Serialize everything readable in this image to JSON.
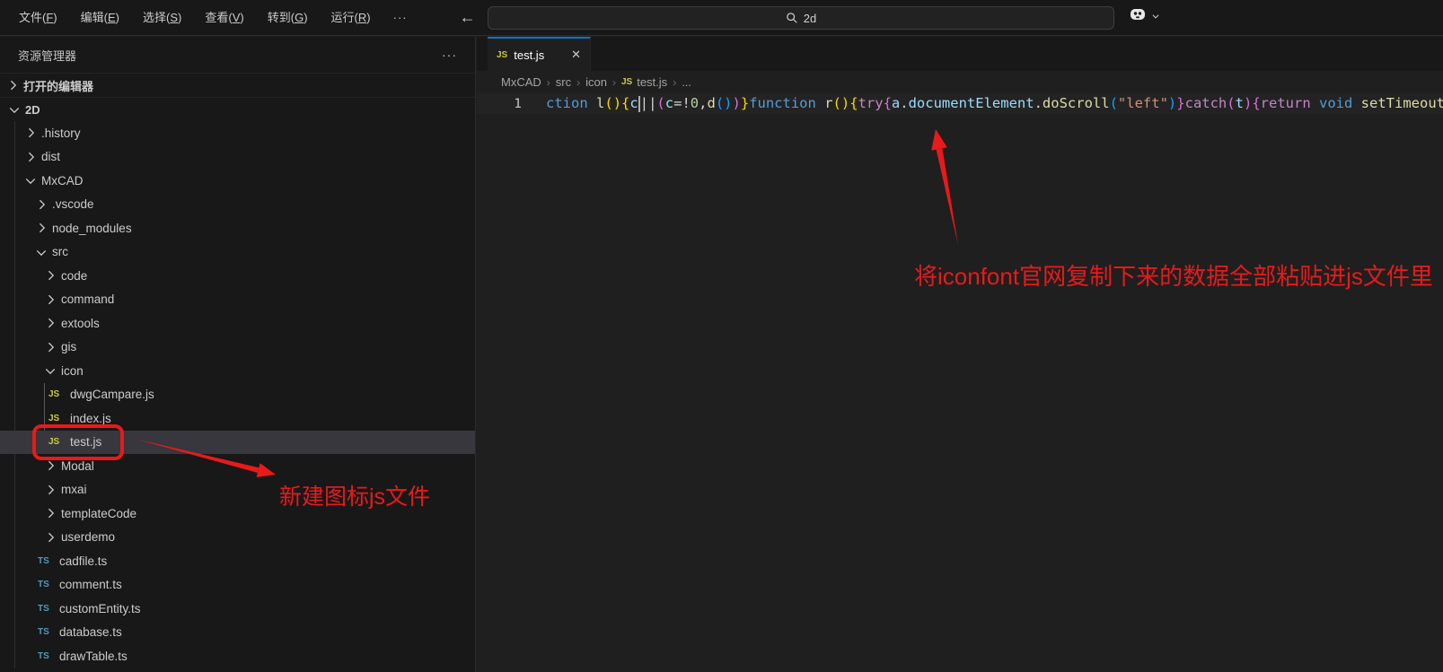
{
  "titlebar": {
    "menus": [
      {
        "text": "文件",
        "key": "F"
      },
      {
        "text": "编辑",
        "key": "E"
      },
      {
        "text": "选择",
        "key": "S"
      },
      {
        "text": "查看",
        "key": "V"
      },
      {
        "text": "转到",
        "key": "G"
      },
      {
        "text": "运行",
        "key": "R"
      }
    ],
    "overflow": "···",
    "search_value": "2d"
  },
  "icons": {
    "close": "✕",
    "js_badge": "JS",
    "ts_badge": "TS",
    "more": "···",
    "back": "←",
    "forward": "→"
  },
  "sidebar": {
    "title": "资源管理器",
    "open_editors_label": "打开的编辑器",
    "root_label": "2D",
    "tree": [
      {
        "name": ".history",
        "kind": "folder",
        "level": 1
      },
      {
        "name": "dist",
        "kind": "folder",
        "level": 1
      },
      {
        "name": "MxCAD",
        "kind": "folder",
        "level": 1,
        "expanded": true
      },
      {
        "name": ".vscode",
        "kind": "folder",
        "level": 2
      },
      {
        "name": "node_modules",
        "kind": "folder",
        "level": 2
      },
      {
        "name": "src",
        "kind": "folder",
        "level": 2,
        "expanded": true
      },
      {
        "name": "code",
        "kind": "folder",
        "level": 3
      },
      {
        "name": "command",
        "kind": "folder",
        "level": 3
      },
      {
        "name": "extools",
        "kind": "folder",
        "level": 3
      },
      {
        "name": "gis",
        "kind": "folder",
        "level": 3
      },
      {
        "name": "icon",
        "kind": "folder",
        "level": 3,
        "expanded": true
      },
      {
        "name": "dwgCampare.js",
        "kind": "js",
        "level": 4
      },
      {
        "name": "index.js",
        "kind": "js",
        "level": 4
      },
      {
        "name": "test.js",
        "kind": "js",
        "level": 4,
        "selected": true
      },
      {
        "name": "Modal",
        "kind": "folder",
        "level": 3
      },
      {
        "name": "mxai",
        "kind": "folder",
        "level": 3
      },
      {
        "name": "templateCode",
        "kind": "folder",
        "level": 3
      },
      {
        "name": "userdemo",
        "kind": "folder",
        "level": 3
      },
      {
        "name": "cadfile.ts",
        "kind": "ts",
        "level": 3
      },
      {
        "name": "comment.ts",
        "kind": "ts",
        "level": 3
      },
      {
        "name": "customEntity.ts",
        "kind": "ts",
        "level": 3
      },
      {
        "name": "database.ts",
        "kind": "ts",
        "level": 3
      },
      {
        "name": "drawTable.ts",
        "kind": "ts",
        "level": 3
      }
    ]
  },
  "editor": {
    "tab": {
      "label": "test.js"
    },
    "breadcrumb": [
      {
        "label": "MxCAD"
      },
      {
        "label": "src"
      },
      {
        "label": "icon"
      },
      {
        "label": "test.js",
        "icon": "js"
      },
      {
        "label": "..."
      }
    ],
    "line_number": "1",
    "code_tokens": [
      {
        "t": "ction",
        "c": "kw"
      },
      {
        "t": " ",
        "c": "fg"
      },
      {
        "t": "l",
        "c": "fn"
      },
      {
        "t": "(",
        "c": "b1"
      },
      {
        "t": ")",
        "c": "b1"
      },
      {
        "t": "{",
        "c": "b1"
      },
      {
        "t": "c",
        "c": "var"
      },
      {
        "t": "",
        "c": "cursor"
      },
      {
        "t": "||",
        "c": "fg"
      },
      {
        "t": "(",
        "c": "b2"
      },
      {
        "t": "c",
        "c": "var"
      },
      {
        "t": "=",
        "c": "fg"
      },
      {
        "t": "!",
        "c": "fg"
      },
      {
        "t": "0",
        "c": "num"
      },
      {
        "t": ",",
        "c": "fg"
      },
      {
        "t": "d",
        "c": "fn"
      },
      {
        "t": "(",
        "c": "b3"
      },
      {
        "t": ")",
        "c": "b3"
      },
      {
        "t": ")",
        "c": "b2"
      },
      {
        "t": "}",
        "c": "b1"
      },
      {
        "t": "function",
        "c": "kw"
      },
      {
        "t": " ",
        "c": "fg"
      },
      {
        "t": "r",
        "c": "fn"
      },
      {
        "t": "(",
        "c": "b1"
      },
      {
        "t": ")",
        "c": "b1"
      },
      {
        "t": "{",
        "c": "b1"
      },
      {
        "t": "try",
        "c": "ctl"
      },
      {
        "t": "{",
        "c": "b2"
      },
      {
        "t": "a",
        "c": "var"
      },
      {
        "t": ".",
        "c": "fg"
      },
      {
        "t": "documentElement",
        "c": "var"
      },
      {
        "t": ".",
        "c": "fg"
      },
      {
        "t": "doScroll",
        "c": "fn"
      },
      {
        "t": "(",
        "c": "b3"
      },
      {
        "t": "\"left\"",
        "c": "str"
      },
      {
        "t": ")",
        "c": "b3"
      },
      {
        "t": "}",
        "c": "b2"
      },
      {
        "t": "catch",
        "c": "ctl"
      },
      {
        "t": "(",
        "c": "b2"
      },
      {
        "t": "t",
        "c": "var"
      },
      {
        "t": ")",
        "c": "b2"
      },
      {
        "t": "{",
        "c": "b2"
      },
      {
        "t": "return",
        "c": "ctl"
      },
      {
        "t": " ",
        "c": "fg"
      },
      {
        "t": "void",
        "c": "kw"
      },
      {
        "t": " ",
        "c": "fg"
      },
      {
        "t": "setTimeout",
        "c": "fn"
      }
    ]
  },
  "annotations": {
    "note_paste": "将iconfont官网复制下来的数据全部粘贴进js文件里",
    "note_newfile": "新建图标js文件"
  },
  "colors": {
    "annotation_red": "#e81a1a",
    "accent_blue": "#0078d4",
    "js_yellow": "#cbcb41",
    "ts_blue": "#519aba",
    "syntax": {
      "kw": "#569cd6",
      "ctl": "#c586c0",
      "fn": "#dcdcaa",
      "var": "#9cdcfe",
      "str": "#ce9178",
      "num": "#b5cea8",
      "fg": "#d4d4d4",
      "b1": "#ffd700",
      "b2": "#da70d6",
      "b3": "#179fff"
    }
  }
}
